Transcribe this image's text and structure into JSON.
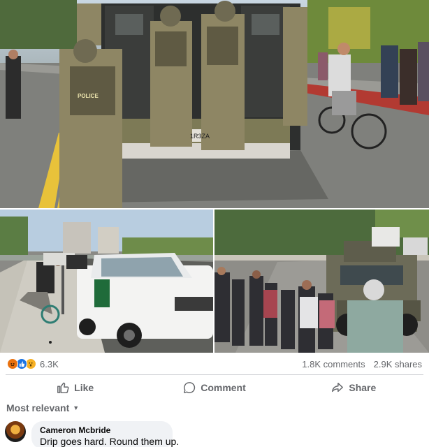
{
  "post": {
    "photos": [
      {
        "name": "armored-vehicle-soldiers-photo"
      },
      {
        "name": "white-pickup-truck-photo"
      },
      {
        "name": "crowd-armored-vehicle-photo"
      }
    ],
    "overlay_text": {
      "police_patch": "POLICE",
      "plate": "1R3ZA"
    }
  },
  "stats": {
    "reaction_icons": [
      "angry-icon",
      "like-icon",
      "wow-icon"
    ],
    "reaction_count": "6.3K",
    "comments": "1.8K comments",
    "shares": "2.9K shares"
  },
  "actions": {
    "like": "Like",
    "comment": "Comment",
    "share": "Share"
  },
  "sort": {
    "label": "Most relevant"
  },
  "comments": [
    {
      "author": "Cameron Mcbride",
      "text": "Drip goes hard. Round them up."
    }
  ],
  "colors": {
    "accent": "#1b74e4",
    "muted": "#65676b",
    "bubble": "#f0f2f5"
  }
}
